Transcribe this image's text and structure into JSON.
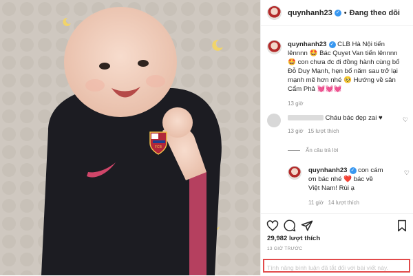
{
  "header": {
    "username": "quynhanh23",
    "verified_mark": "✓",
    "separator": "•",
    "follow_status": "Đang theo dõi",
    "more_icon": "more-dots-icon"
  },
  "photo": {
    "description_icon": "baby-photo",
    "jersey_crest_text": "FCB"
  },
  "caption": {
    "username": "quynhanh23",
    "text_1": " CLB Hà Nội tiến lênnnn 🤩 Bác Quyet Van tiến lênnnn 🤩 con chưa đc đi đồng hành cùng bố Đỗ Duy Mạnh, hẹn bố năm sau trở lại mạnh mẽ hơn nhé 🥺 Hướng về sân Cẩm Phả 💓💓💓",
    "time": "13 giờ"
  },
  "comment_1": {
    "text": "Cháu bác đẹp zai ♥",
    "time": "13 giờ",
    "likes": "15 lượt thích"
  },
  "replies_toggle": "Ẩn câu trả lời",
  "reply_1": {
    "username": "quynhanh23",
    "text": " con cám ơn bác nhé ❤️ bác về Việt Nam! Rùi ạ",
    "time": "11 giờ",
    "likes": "14 lượt thích"
  },
  "actions": {
    "likes": "29,982 lượt thích",
    "timestamp": "13 GIỜ TRƯỚC",
    "comments_disabled": "Tính năng bình luận đã tắt đối với bài viết này."
  },
  "colors": {
    "verified": "#3897f0",
    "highlight_box": "#e24a4a",
    "muted_text": "#8e8e8e"
  }
}
